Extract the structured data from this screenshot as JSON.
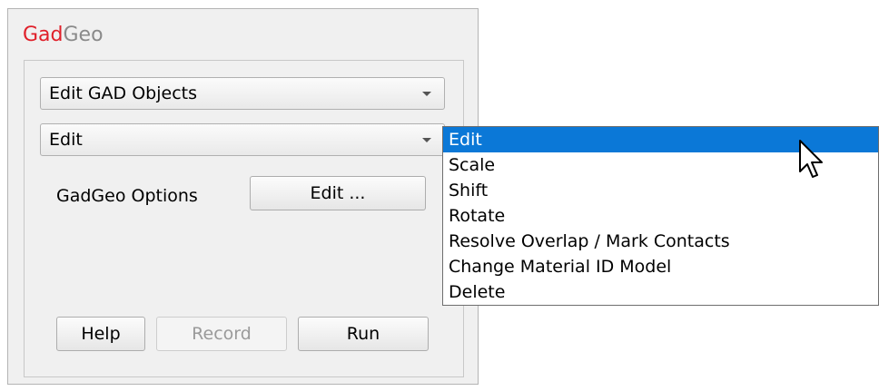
{
  "panel": {
    "title_part1": "Gad",
    "title_part2": "Geo",
    "accent_color": "#e0202a"
  },
  "object_combo": {
    "value": "Edit GAD Objects"
  },
  "action_combo": {
    "value": "Edit"
  },
  "options": {
    "label": "GadGeo Options",
    "button_label": "Edit ..."
  },
  "buttons": {
    "help": "Help",
    "record": "Record",
    "run": "Run"
  },
  "dropdown": {
    "items": [
      "Edit",
      "Scale",
      "Shift",
      "Rotate",
      "Resolve Overlap / Mark Contacts",
      "Change Material ID Model",
      "Delete"
    ],
    "selected_index": 0,
    "highlight_color": "#0b78d7"
  },
  "cursor_icon": "arrow-pointer-icon"
}
